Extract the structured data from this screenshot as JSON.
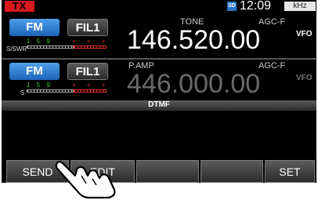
{
  "status": {
    "tx_label": "TX",
    "sd_icon": "sd-card-icon",
    "sd_label": "SD",
    "time": "12:09",
    "unit_label": "kHz"
  },
  "main_band": {
    "mode": "FM",
    "filter": "FIL1",
    "meter_label": "S/SWR",
    "meter_scale": "1 5 9",
    "tone_label": "TONE",
    "agc_label": "AGC-F",
    "frequency": "146.520.00",
    "vfo_label": "VFO"
  },
  "sub_band": {
    "mode": "FM",
    "filter": "FIL1",
    "meter_label": "S",
    "meter_scale": "1 5 9",
    "preamp_label": "P.AMP",
    "agc_label": "AGC-F",
    "frequency": "446.000.00",
    "vfo_label": "VFO"
  },
  "dtmf": {
    "title": "DTMF"
  },
  "softkeys": {
    "send": "SEND",
    "edit": "EDIT",
    "key3": "",
    "key4": "",
    "set": "SET"
  },
  "colors": {
    "tx": "#d8191e",
    "mode_button": "#1c63b8",
    "meter_green": "#3ec43e",
    "meter_red": "#e0302a"
  }
}
